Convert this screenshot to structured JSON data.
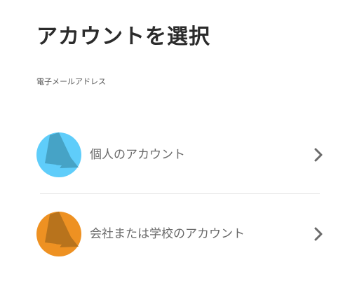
{
  "page": {
    "title": "アカウントを選択",
    "email": "電子メールアドレス"
  },
  "accounts": [
    {
      "label": "個人のアカウント",
      "avatar_color": "#5fcdfa",
      "avatar_shade": "#46a3c6",
      "icon": "personal-account-avatar-icon"
    },
    {
      "label": "会社または学校のアカウント",
      "avatar_color": "#ee9122",
      "avatar_shade": "#b8731c",
      "icon": "work-account-avatar-icon"
    }
  ],
  "colors": {
    "title": "#2b2b2b",
    "label": "#6a6a6a",
    "chevron": "#6b6b6b",
    "divider": "#e4e4e4"
  },
  "icons": {
    "chevron": "chevron-right-icon"
  }
}
